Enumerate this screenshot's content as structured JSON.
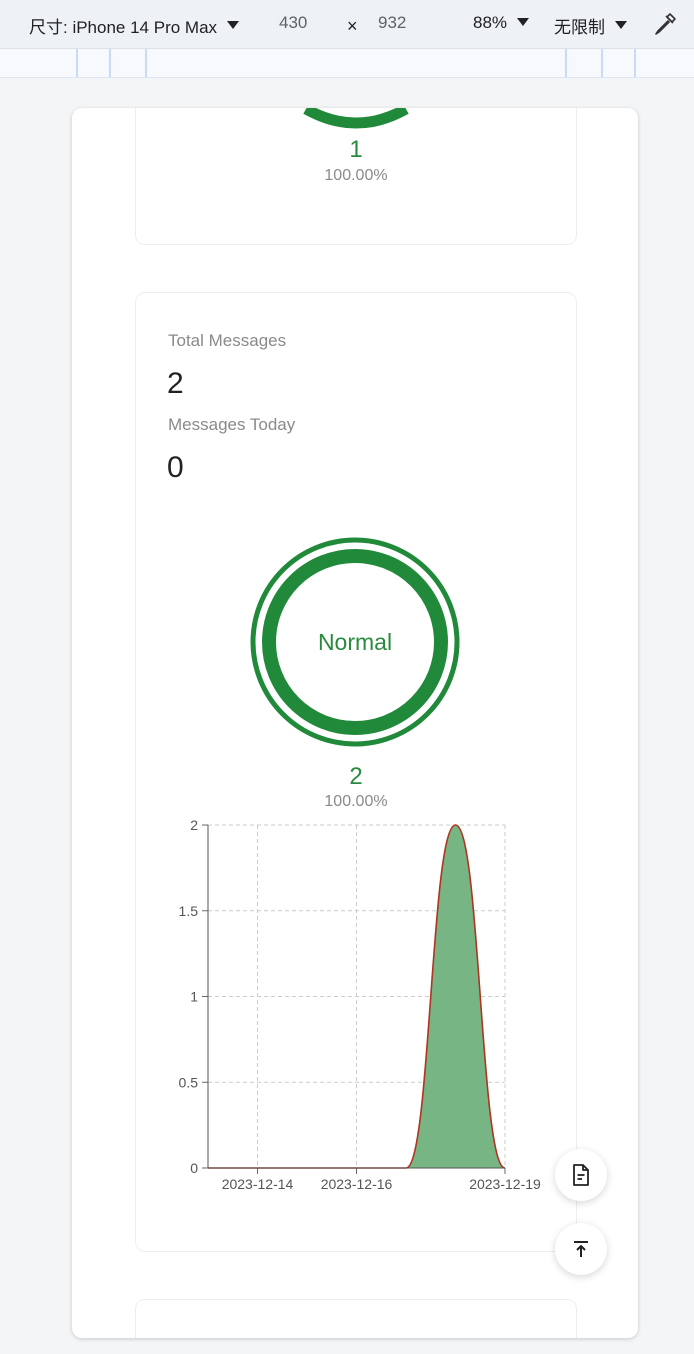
{
  "devtools": {
    "device_label": "尺寸: iPhone 14 Pro Max",
    "width": "430",
    "times": "×",
    "height": "932",
    "zoom": "88%",
    "throttle": "无限制"
  },
  "card_top": {
    "count": "1",
    "percent": "100.00%"
  },
  "messages": {
    "total_label": "Total Messages",
    "total_value": "2",
    "today_label": "Messages Today",
    "today_value": "0",
    "status": "Normal",
    "count": "2",
    "percent": "100.00%"
  },
  "chart_data": {
    "type": "area",
    "x": [
      "2023-12-13",
      "2023-12-14",
      "2023-12-15",
      "2023-12-16",
      "2023-12-17",
      "2023-12-18",
      "2023-12-19"
    ],
    "values": [
      0,
      0,
      0,
      0,
      0,
      2,
      0
    ],
    "x_tick_labels": [
      "2023-12-14",
      "2023-12-16",
      "2023-12-19"
    ],
    "y_ticks": [
      0,
      0.5,
      1,
      1.5,
      2
    ],
    "ylim": [
      0,
      2
    ],
    "title": "",
    "xlabel": "",
    "ylabel": "",
    "grid": true,
    "colors": {
      "line": "#b0341f",
      "fill": "#77b585",
      "grid": "#cccccc"
    }
  },
  "fabs": {
    "doc_icon": "document-icon",
    "top_icon": "back-to-top-icon"
  },
  "colors": {
    "accent": "#218a3a"
  }
}
